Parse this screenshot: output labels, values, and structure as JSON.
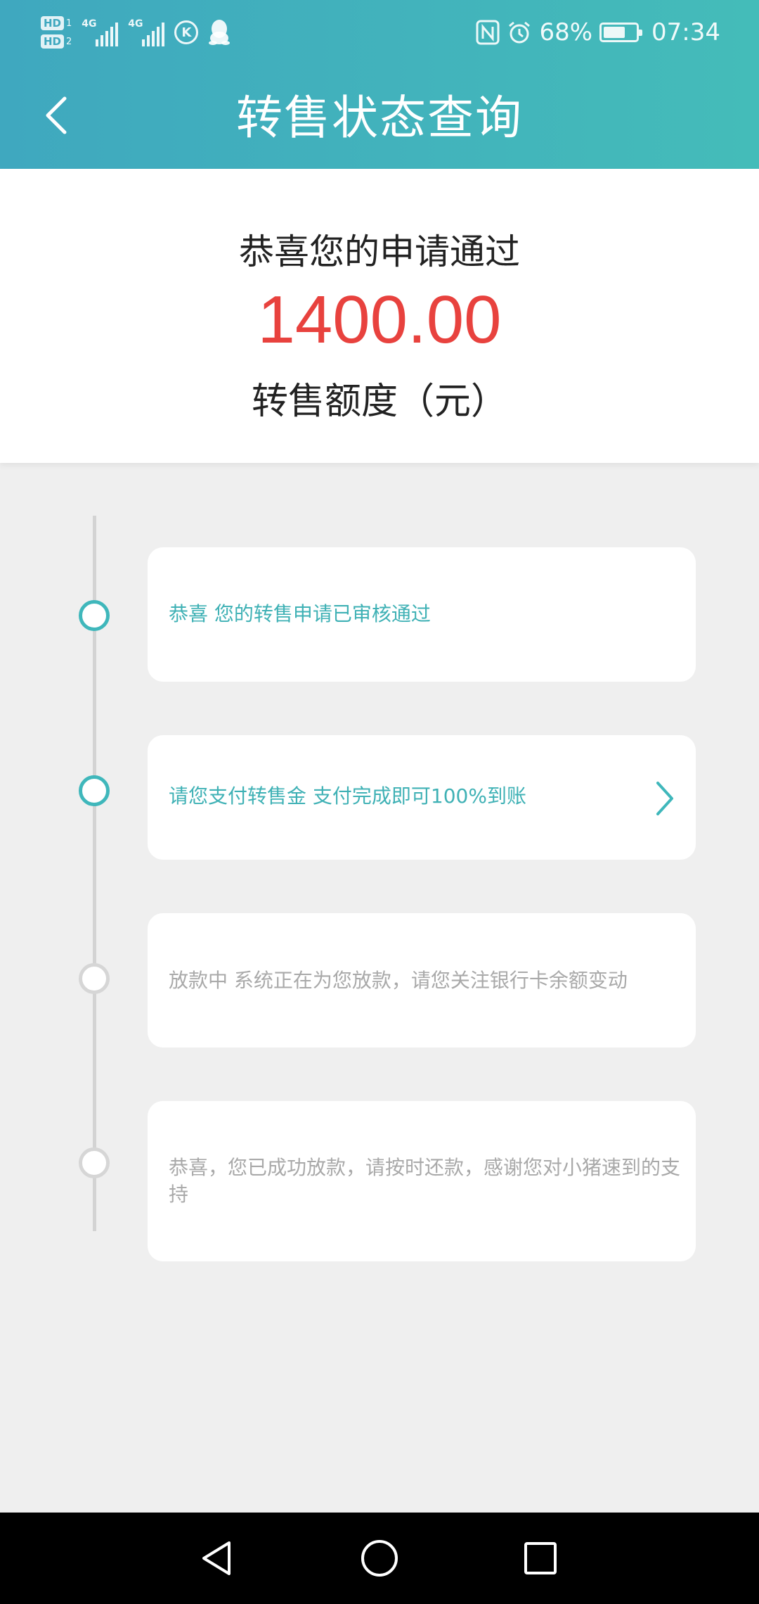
{
  "status_bar": {
    "hd1": "HD",
    "hd1_num": "1",
    "hd2": "HD",
    "hd2_num": "2",
    "sim1_label": "4G",
    "sim2_label": "4G",
    "app_badge": "K",
    "battery_percent": "68%",
    "battery_level": 0.68,
    "time": "07:34"
  },
  "header": {
    "title": "转售状态查询",
    "back_icon": "chevron-left-icon"
  },
  "summary": {
    "congrats": "恭喜您的申请通过",
    "amount": "1400.00",
    "amount_label": "转售额度（元）",
    "amount_color": "#e8423e"
  },
  "steps": [
    {
      "text": "恭喜 您的转售申请已审核通过",
      "status": "active"
    },
    {
      "text": "请您支付转售金 支付完成即可100%到账",
      "status": "active",
      "has_arrow": true
    },
    {
      "text": "放款中 系统正在为您放款，请您关注银行卡余额变动",
      "status": "inactive"
    },
    {
      "text": "恭喜，您已成功放款，请按时还款，感谢您对小猪速到的支持",
      "status": "inactive"
    }
  ],
  "colors": {
    "accent": "#3fb7bb",
    "header_start": "#3fa8bf",
    "header_end": "#44bcb9",
    "inactive": "#a9a9a9",
    "background": "#efefef"
  },
  "navbar": {
    "back": "triangle-back-icon",
    "home": "circle-home-icon",
    "recents": "square-recents-icon"
  }
}
